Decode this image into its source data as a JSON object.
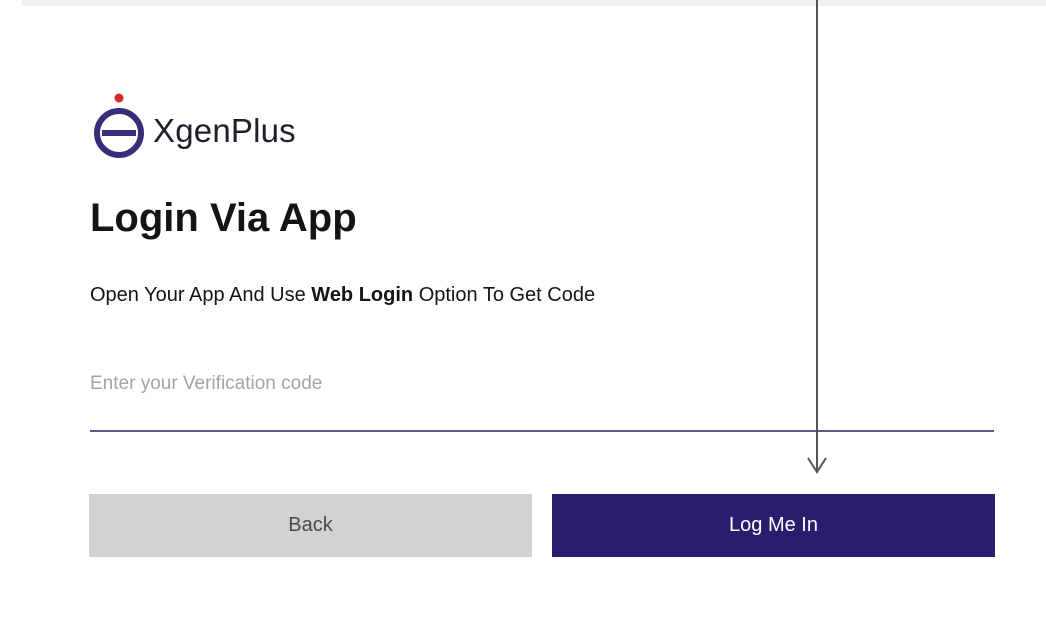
{
  "brand": {
    "name": "XgenPlus",
    "logo_icon": "xgenplus-e-logo-icon",
    "logo_color": "#3b2c7a",
    "dot_color": "#d62828"
  },
  "login": {
    "title": "Login Via App",
    "instruction_prefix": "Open Your App And Use ",
    "instruction_bold": "Web Login",
    "instruction_suffix": " Option To Get Code",
    "code_placeholder": "Enter your Verification code",
    "code_value": ""
  },
  "buttons": {
    "back_label": "Back",
    "login_label": "Log Me In"
  },
  "annotation": {
    "arrow_icon": "down-arrow-icon",
    "arrow_color": "#555555"
  },
  "colors": {
    "primary": "#2b1d6e",
    "secondary_button": "#d2d2d4",
    "input_underline": "#5b5a86"
  }
}
